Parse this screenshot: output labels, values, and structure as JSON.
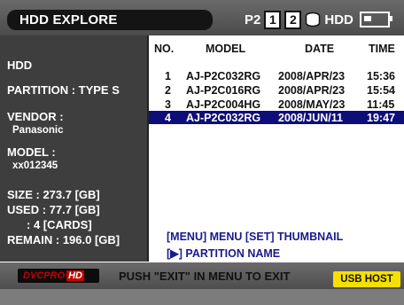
{
  "header": {
    "title": "HDD EXPLORE",
    "media": "P2",
    "slots": [
      "1",
      "2"
    ],
    "hdd_label": "HDD"
  },
  "info": {
    "device": "HDD",
    "partition": "PARTITION : TYPE S",
    "vendor_label": "VENDOR :",
    "vendor_value": "Panasonic",
    "model_label": "MODEL :",
    "model_value": "xx012345",
    "size": "SIZE : 273.7 [GB]",
    "used": "USED :  77.7 [GB]",
    "cards": ": 4 [CARDS]",
    "remain": "REMAIN : 196.0 [GB]"
  },
  "table": {
    "columns": [
      "NO.",
      "MODEL",
      "DATE",
      "TIME"
    ],
    "rows": [
      {
        "no": "1",
        "model": "AJ-P2C032RG",
        "date": "2008/APR/23",
        "time": "15:36"
      },
      {
        "no": "2",
        "model": "AJ-P2C016RG",
        "date": "2008/APR/23",
        "time": "15:54"
      },
      {
        "no": "3",
        "model": "AJ-P2C004HG",
        "date": "2008/MAY/23",
        "time": "11:45"
      },
      {
        "no": "4",
        "model": "AJ-P2C032RG",
        "date": "2008/JUN/11",
        "time": "19:47"
      }
    ],
    "selected_row": "4"
  },
  "help": {
    "line1": "[MENU] MENU   [SET] THUMBNAIL",
    "line2": "[▶] PARTITION NAME"
  },
  "footer": {
    "logo_left": "DVCPRO",
    "logo_right": "HD",
    "message": "PUSH \"EXIT\" IN MENU TO EXIT",
    "usb": "USB HOST"
  },
  "colors": {
    "selection": "#0e0e78",
    "help_text": "#1a1a8c",
    "usb_badge": "#f6e000",
    "logo_red": "#c40000"
  }
}
